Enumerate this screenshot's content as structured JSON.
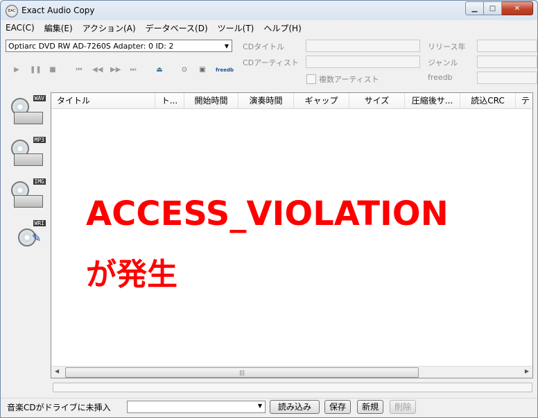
{
  "window": {
    "title": "Exact Audio Copy",
    "icon_text": "EAC"
  },
  "menu": [
    "EAC(C)",
    "編集(E)",
    "アクション(A)",
    "データベース(D)",
    "ツール(T)",
    "ヘルプ(H)"
  ],
  "drive": {
    "selected": "Optiarc DVD RW AD-7260S   Adapter: 0  ID: 2"
  },
  "cd_info": {
    "cd_title_label": "CDタイトル",
    "cd_artist_label": "CDアーティスト",
    "multi_artist_label": "複数アーティスト",
    "release_year_label": "リリース年",
    "genre_label": "ジャンル",
    "freedb_label": "freedb",
    "freedb_button": "freedb"
  },
  "sidebar": [
    "WAV",
    "MP3",
    "IMG",
    "WRI"
  ],
  "columns": [
    "タイトル",
    "ト...",
    "開始時間",
    "演奏時間",
    "ギャップ",
    "サイズ",
    "圧縮後サ...",
    "読込CRC",
    "テ"
  ],
  "error": {
    "line1": "ACCESS_VIOLATION",
    "line2": "が発生"
  },
  "statusbar": {
    "message": "音楽CDがドライブに未挿入",
    "read_button": "読み込み",
    "save_button": "保存",
    "new_button": "新規",
    "delete_button": "削除"
  }
}
